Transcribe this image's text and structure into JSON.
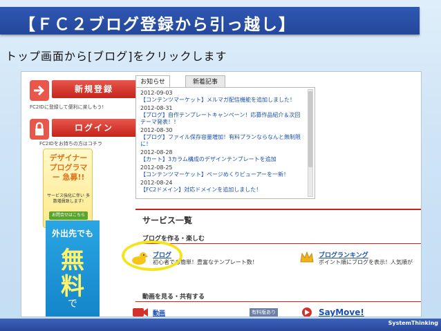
{
  "slide": {
    "title": "【ＦＣ２ブログ登録から引っ越し】",
    "subtitle": "トップ画面から[ブログ]をクリックします",
    "footer": "SystemThinking"
  },
  "sidebar": {
    "register_button": "新規登録",
    "register_note": "FC2IDに登録して便利に楽しもう!",
    "login_button": "ログイン",
    "login_note": "FC2IDをお持ちの方はコチラ",
    "designer_banner": {
      "title": "デザイナー プログラマー 急募!!",
      "sub": "サービス強化に伴い 多数増員致します!",
      "button": "お問合せはこちら"
    },
    "ad_banner": {
      "top": "外出先でも",
      "big1": "無",
      "big2": "料",
      "small": "で"
    }
  },
  "news": {
    "tabs": [
      "お知らせ",
      "新着記事"
    ],
    "items": [
      {
        "date": "2012-09-03",
        "text": "【コンテンツマーケット】メルマガ配信機能を追加しました！"
      },
      {
        "date": "2012-08-31",
        "text": "【ブログ】自作テンプレートキャンペーン！応募作品紹介＆次回テーマ発表！！"
      },
      {
        "date": "2012-08-30",
        "text": "【ブログ】ファイル保存容量増加！有料プランならなんと無制限に！"
      },
      {
        "date": "2012-08-28",
        "text": "【カート】3カラム構成のデザインテンプレートを追加"
      },
      {
        "date": "2012-08-25",
        "text": "【コンテンツマーケット】ページめくりビューアーを一新！"
      },
      {
        "date": "2012-08-24",
        "text": "【FC2ドメイン】対応ドメインを追加しました！"
      }
    ]
  },
  "services": {
    "heading": "サービス一覧",
    "section1": "ブログを作る・楽しむ",
    "blog_link": "ブログ",
    "blog_desc": "初心者でも簡単！豊富なテンプレート数！",
    "ranking_link": "ブログランキング",
    "ranking_desc": "ポイント順にブログを表示！人気順が",
    "section2": "動画を見る・共有する",
    "video_link": "動画",
    "video_badge": "有料版あり",
    "saymove_link": "SayMove!"
  },
  "colors": {
    "title_bar": "#2a4fa8",
    "red_button": "#d1332a",
    "highlight": "#f4e51b",
    "link_blue": "#1a4fb2"
  }
}
